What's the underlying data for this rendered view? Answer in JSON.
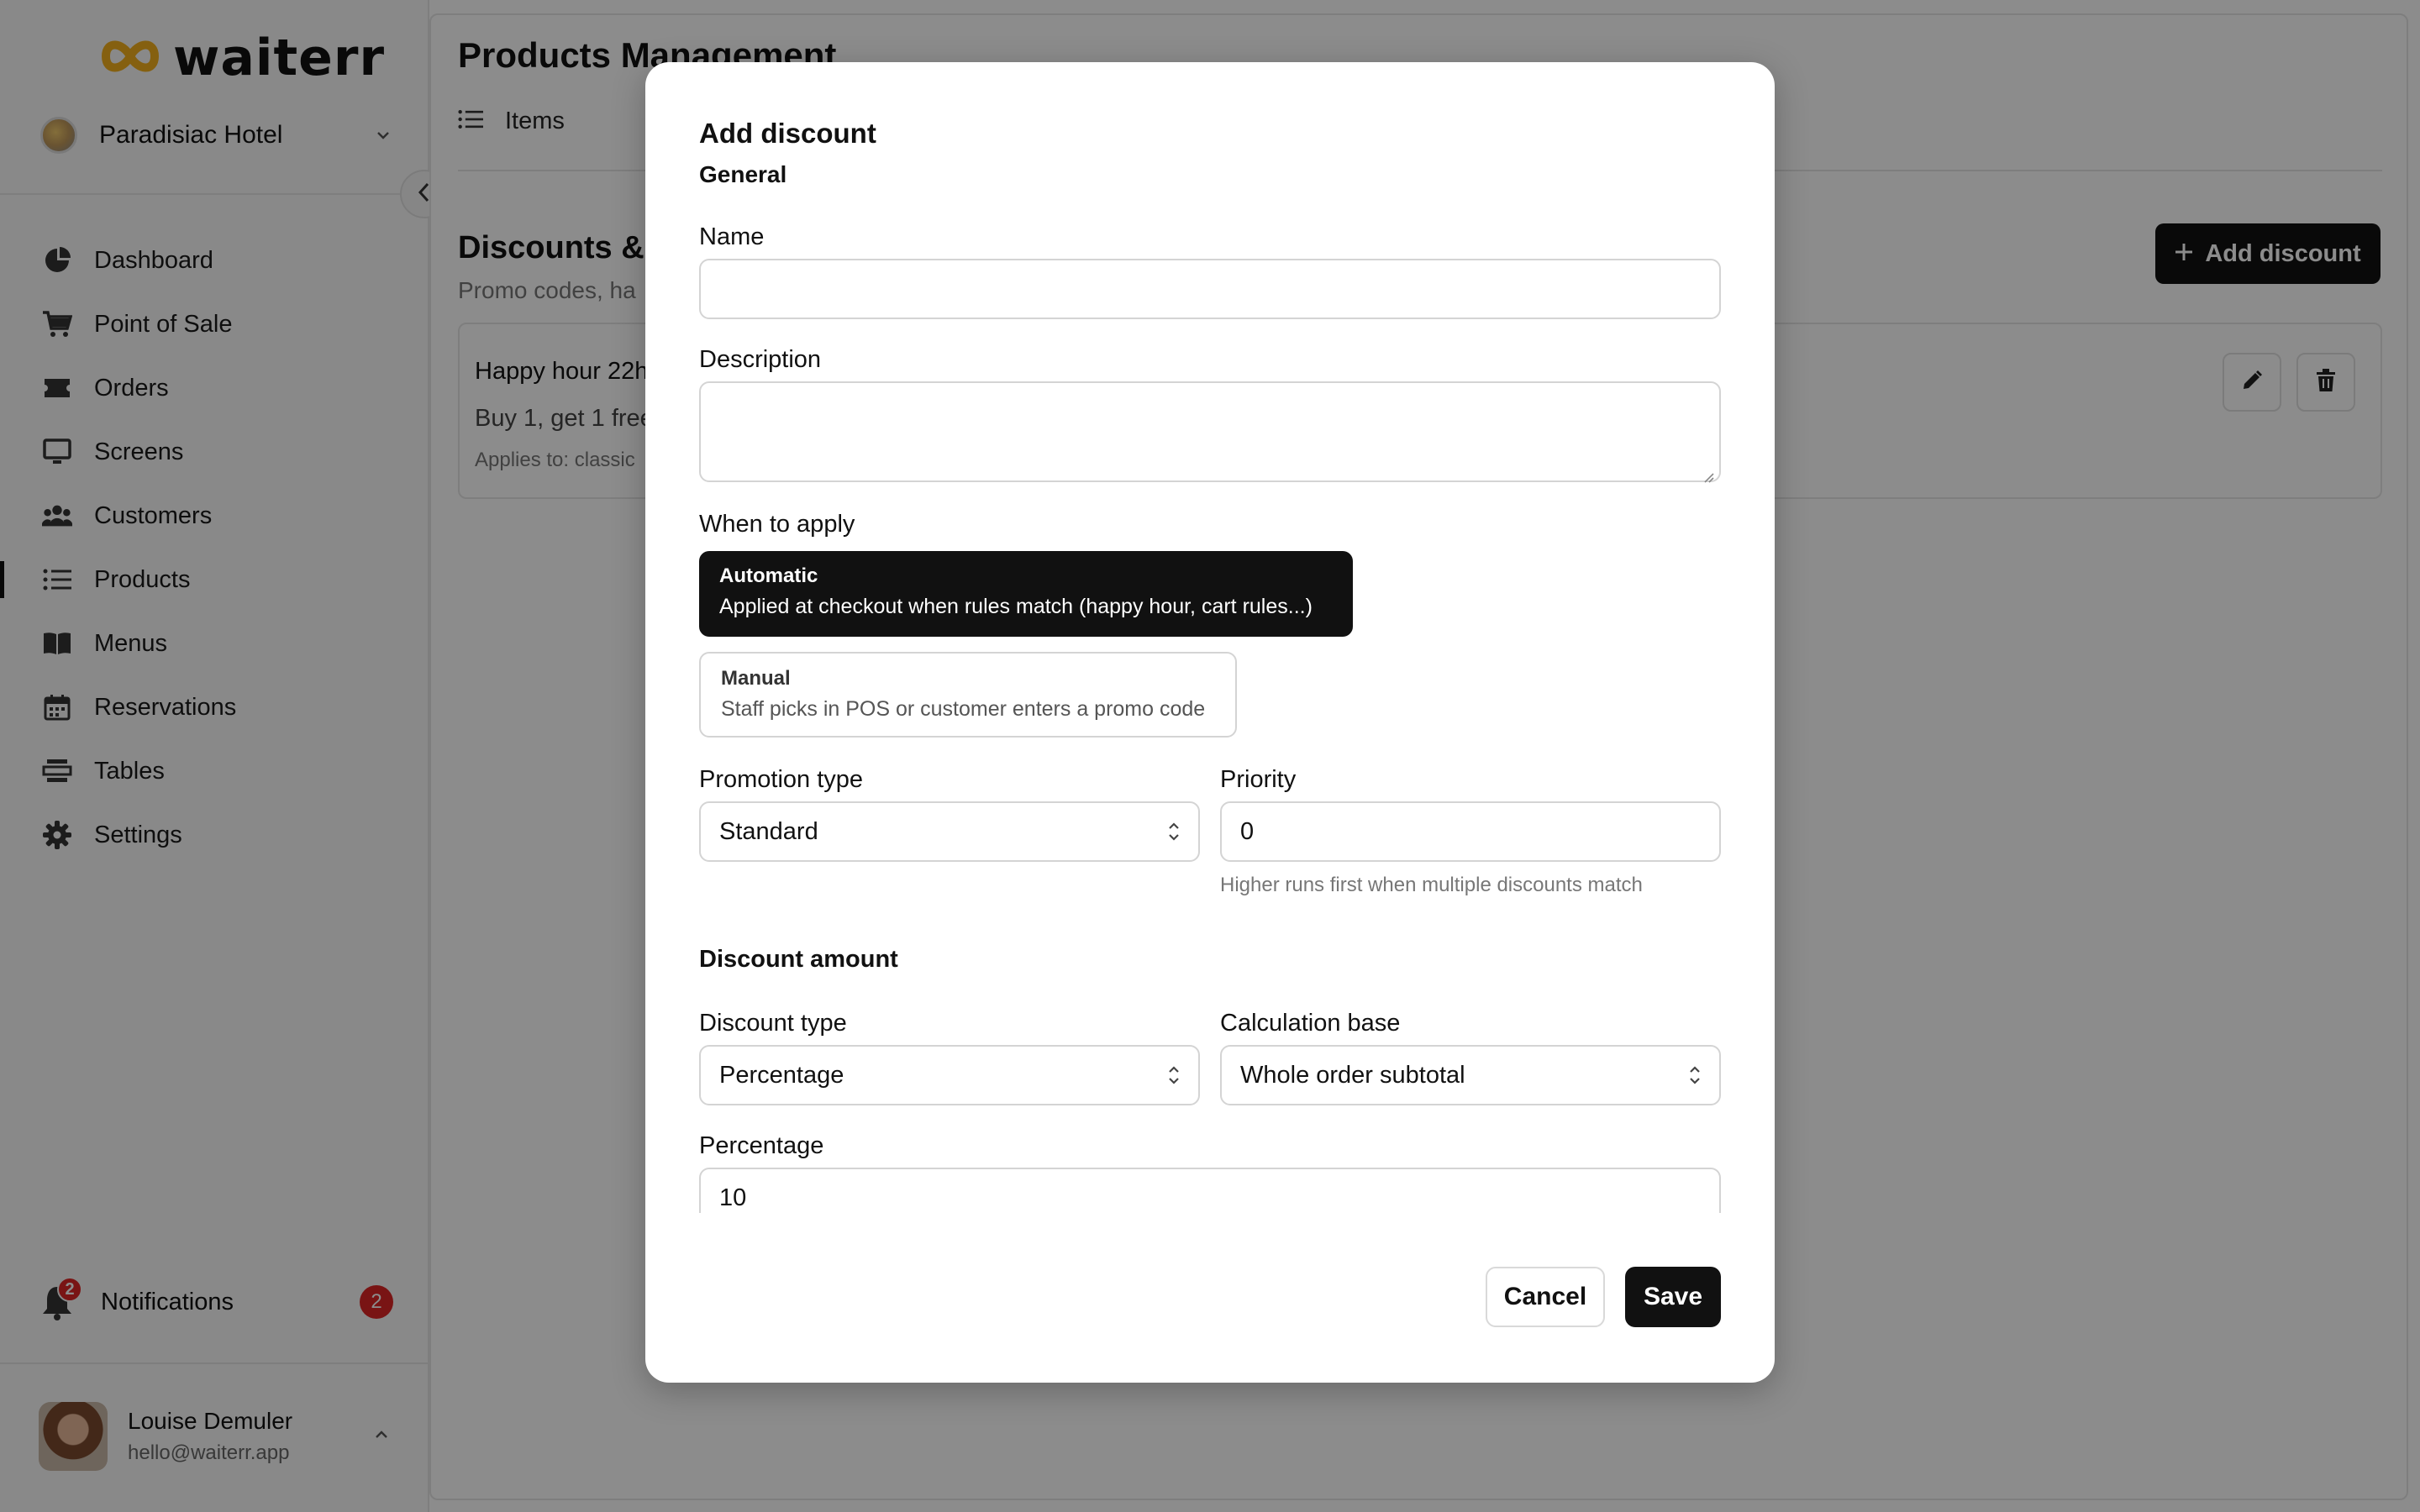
{
  "brand": {
    "name": "waiterr",
    "accent": "#f2b01e"
  },
  "venue": {
    "name": "Paradisiac Hotel"
  },
  "nav": {
    "items": [
      {
        "label": "Dashboard",
        "icon": "pie-chart-icon"
      },
      {
        "label": "Point of Sale",
        "icon": "cart-icon"
      },
      {
        "label": "Orders",
        "icon": "ticket-icon"
      },
      {
        "label": "Screens",
        "icon": "monitor-icon"
      },
      {
        "label": "Customers",
        "icon": "users-icon"
      },
      {
        "label": "Products",
        "icon": "list-icon",
        "active": true
      },
      {
        "label": "Menus",
        "icon": "book-icon"
      },
      {
        "label": "Reservations",
        "icon": "calendar-icon"
      },
      {
        "label": "Tables",
        "icon": "table-icon"
      },
      {
        "label": "Settings",
        "icon": "gear-icon"
      }
    ]
  },
  "notifications": {
    "label": "Notifications",
    "badge": "2",
    "count": "2"
  },
  "user": {
    "name": "Louise Demuler",
    "email": "hello@waiterr.app"
  },
  "main": {
    "title": "Products Management",
    "tab_items": "Items",
    "section_title": "Discounts & p",
    "section_subtitle": "Promo codes, ha",
    "add_button": "Add discount",
    "card": {
      "title": "Happy hour 22h",
      "description": "Buy 1, get 1 free",
      "applies": "Applies to: classic"
    }
  },
  "modal": {
    "title": "Add discount",
    "general": "General",
    "name_label": "Name",
    "name_value": "",
    "description_label": "Description",
    "description_value": "",
    "when_label": "When to apply",
    "automatic": {
      "title": "Automatic",
      "desc": "Applied at checkout when rules match (happy hour, cart rules...)"
    },
    "manual": {
      "title": "Manual",
      "desc": "Staff picks in POS or customer enters a promo code"
    },
    "promotion_type_label": "Promotion type",
    "promotion_type_value": "Standard",
    "priority_label": "Priority",
    "priority_value": "0",
    "priority_hint": "Higher runs first when multiple discounts match",
    "discount_amount": "Discount amount",
    "discount_type_label": "Discount type",
    "discount_type_value": "Percentage",
    "calc_base_label": "Calculation base",
    "calc_base_value": "Whole order subtotal",
    "percentage_label": "Percentage",
    "percentage_value": "10",
    "cancel": "Cancel",
    "save": "Save"
  }
}
